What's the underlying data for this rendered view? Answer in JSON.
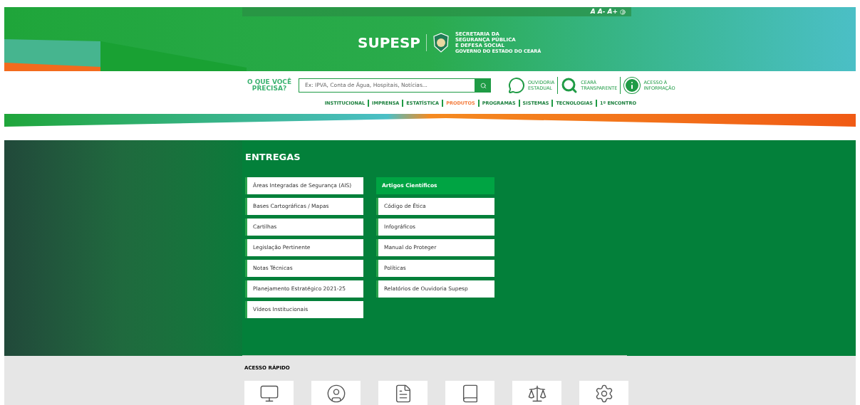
{
  "accessibility": {
    "font_buttons": [
      "A",
      "A-",
      "A+"
    ]
  },
  "logo": {
    "name": "SUPESP",
    "lines": [
      "SECRETARIA DA",
      "SEGURANÇA PÚBLICA",
      "E DEFESA SOCIAL"
    ],
    "subline": "GOVERNO DO ESTADO DO CEARÁ"
  },
  "search": {
    "label": "O QUE VOCÊ PRECISA?",
    "placeholder": "Ex: IPVA, Conta de Água, Hospitais, Notícias..."
  },
  "shortcuts": [
    {
      "kind": "chat",
      "label": [
        "OUVIDORIA",
        "ESTADUAL"
      ]
    },
    {
      "kind": "search",
      "label": [
        "CEARÁ",
        "TRANSPARENTE"
      ]
    },
    {
      "kind": "info",
      "label": [
        "ACESSO À",
        "INFORMAÇÃO"
      ]
    }
  ],
  "nav": [
    {
      "label": "INSTITUCIONAL",
      "selected": false
    },
    {
      "label": "IMPRENSA",
      "selected": false
    },
    {
      "label": "ESTATÍSTICA",
      "selected": false
    },
    {
      "label": "PRODUTOS",
      "selected": true
    },
    {
      "label": "PROGRAMAS",
      "selected": false
    },
    {
      "label": "SISTEMAS",
      "selected": false
    },
    {
      "label": "TECNOLOGIAS",
      "selected": false
    },
    {
      "label": "1º ENCONTRO",
      "selected": false
    }
  ],
  "section_title": "ENTREGAS",
  "columns": [
    [
      {
        "label": "Áreas Integradas de Segurança (AIS)",
        "selected": false
      },
      {
        "label": "Bases Cartográficas / Mapas",
        "selected": false
      },
      {
        "label": "Cartilhas",
        "selected": false
      },
      {
        "label": "Legislação Pertinente",
        "selected": false
      },
      {
        "label": "Notas Técnicas",
        "selected": false
      },
      {
        "label": "Planejamento Estratégico 2021-25",
        "selected": false
      },
      {
        "label": "Vídeos Institucionais",
        "selected": false
      }
    ],
    [
      {
        "label": "Artigos Científicos",
        "selected": true
      },
      {
        "label": "Código de Ética",
        "selected": false
      },
      {
        "label": "Infográficos",
        "selected": false
      },
      {
        "label": "Manual do Proteger",
        "selected": false
      },
      {
        "label": "Políticas",
        "selected": false
      },
      {
        "label": "Relatórios de Ouvidoria Supesp",
        "selected": false
      }
    ]
  ],
  "quick_access": {
    "title": "ACESSO RÁPIDO",
    "items": [
      {
        "kind": "monitor"
      },
      {
        "kind": "user"
      },
      {
        "kind": "document"
      },
      {
        "kind": "book"
      },
      {
        "kind": "scales"
      },
      {
        "kind": "gears"
      }
    ]
  }
}
